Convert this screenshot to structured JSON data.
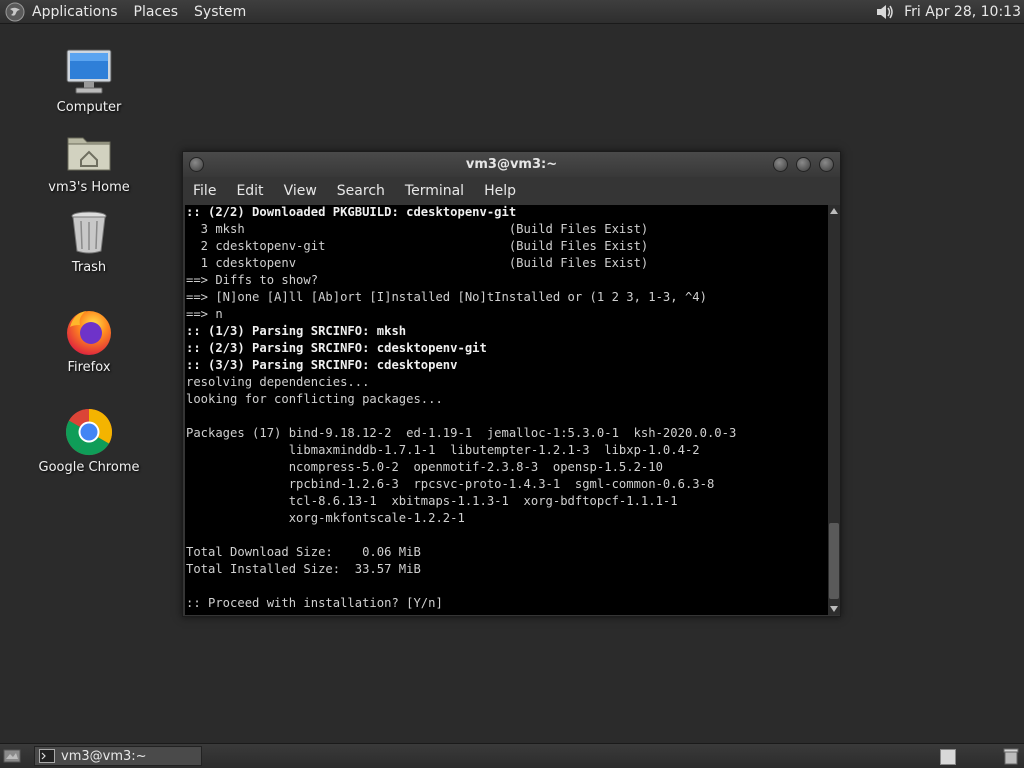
{
  "top_panel": {
    "menus": [
      "Applications",
      "Places",
      "System"
    ],
    "clock": "Fri Apr 28, 10:13"
  },
  "desktop_icons": [
    {
      "label": "Computer",
      "icon": "computer-icon"
    },
    {
      "label": "vm3's Home",
      "icon": "home-folder-icon"
    },
    {
      "label": "Trash",
      "icon": "trash-icon"
    },
    {
      "label": "Firefox",
      "icon": "firefox-icon"
    },
    {
      "label": "Google Chrome",
      "icon": "chrome-icon"
    }
  ],
  "terminal": {
    "title": "vm3@vm3:~",
    "menu": [
      "File",
      "Edit",
      "View",
      "Search",
      "Terminal",
      "Help"
    ],
    "lines": [
      {
        "text": ":: (2/2) Downloaded PKGBUILD: cdesktopenv-git",
        "bold": true
      },
      {
        "text": "  3 mksh                                    (Build Files Exist)",
        "bold": false
      },
      {
        "text": "  2 cdesktopenv-git                         (Build Files Exist)",
        "bold": false
      },
      {
        "text": "  1 cdesktopenv                             (Build Files Exist)",
        "bold": false
      },
      {
        "text": "==> Diffs to show?",
        "bold": false
      },
      {
        "text": "==> [N]one [A]ll [Ab]ort [I]nstalled [No]tInstalled or (1 2 3, 1-3, ^4)",
        "bold": false
      },
      {
        "text": "==> n",
        "bold": false
      },
      {
        "text": ":: (1/3) Parsing SRCINFO: mksh",
        "bold": true
      },
      {
        "text": ":: (2/3) Parsing SRCINFO: cdesktopenv-git",
        "bold": true
      },
      {
        "text": ":: (3/3) Parsing SRCINFO: cdesktopenv",
        "bold": true
      },
      {
        "text": "resolving dependencies...",
        "bold": false
      },
      {
        "text": "looking for conflicting packages...",
        "bold": false
      },
      {
        "text": "",
        "bold": false
      },
      {
        "text": "Packages (17) bind-9.18.12-2  ed-1.19-1  jemalloc-1:5.3.0-1  ksh-2020.0.0-3",
        "bold": false
      },
      {
        "text": "              libmaxminddb-1.7.1-1  libutempter-1.2.1-3  libxp-1.0.4-2",
        "bold": false
      },
      {
        "text": "              ncompress-5.0-2  openmotif-2.3.8-3  opensp-1.5.2-10",
        "bold": false
      },
      {
        "text": "              rpcbind-1.2.6-3  rpcsvc-proto-1.4.3-1  sgml-common-0.6.3-8",
        "bold": false
      },
      {
        "text": "              tcl-8.6.13-1  xbitmaps-1.1.3-1  xorg-bdftopcf-1.1.1-1",
        "bold": false
      },
      {
        "text": "              xorg-mkfontscale-1.2.2-1",
        "bold": false
      },
      {
        "text": "",
        "bold": false
      },
      {
        "text": "Total Download Size:    0.06 MiB",
        "bold": false
      },
      {
        "text": "Total Installed Size:  33.57 MiB",
        "bold": false
      },
      {
        "text": "",
        "bold": false
      },
      {
        "text": ":: Proceed with installation? [Y/n]",
        "bold": false
      }
    ]
  },
  "taskbar": {
    "task_label": "vm3@vm3:~"
  }
}
